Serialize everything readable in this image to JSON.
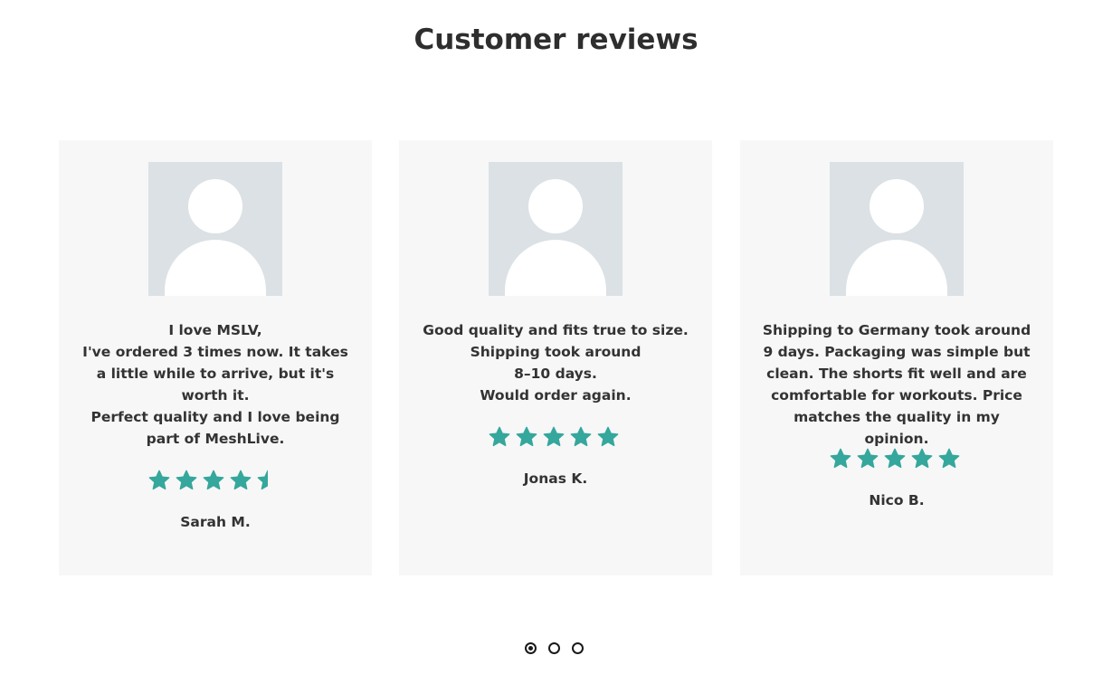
{
  "section": {
    "title": "Customer reviews"
  },
  "colors": {
    "star": "#35a79c",
    "card_bg": "#f7f7f7",
    "avatar_bg": "#dbe1e4"
  },
  "reviews": [
    {
      "text": "I love MSLV,\nI've ordered 3 times now. It takes a little while to arrive, but it's worth it.\nPerfect quality and I love being part of MeshLive.",
      "rating": 4.5,
      "author": "Sarah M.",
      "avatar_icon": "user-placeholder-icon"
    },
    {
      "text": "Good quality and fits true to size.\nShipping took around\n8–10 days.\nWould order again.",
      "rating": 5,
      "author": "Jonas K.",
      "avatar_icon": "user-placeholder-icon"
    },
    {
      "text": "Shipping to Germany took around 9 days. Packaging was simple but clean. The shorts fit well and are comfortable for workouts. Price matches the quality in my opinion.",
      "rating": 5,
      "author": "Nico B.",
      "avatar_icon": "user-placeholder-icon"
    }
  ],
  "pagination": {
    "pages": 3,
    "active": 0
  }
}
